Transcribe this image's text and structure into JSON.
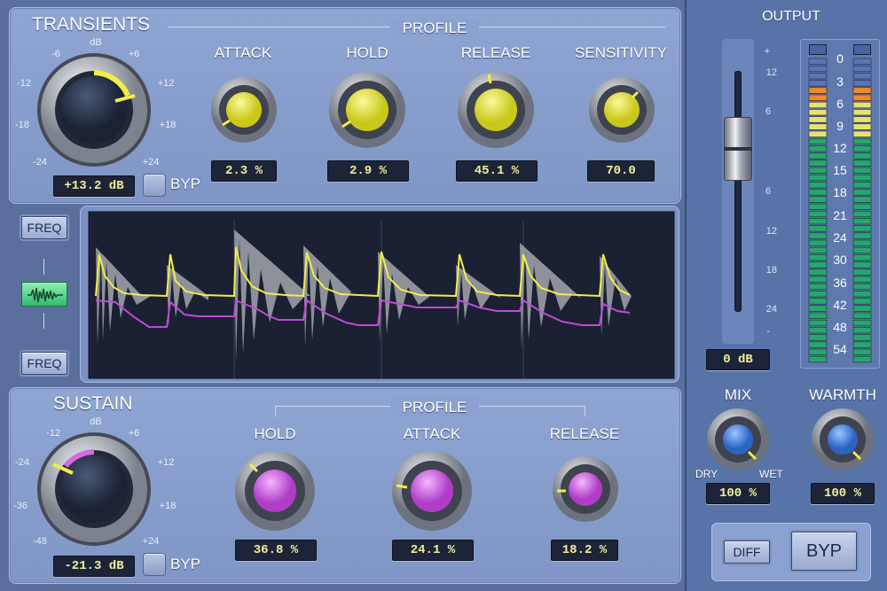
{
  "transients": {
    "title": "TRANSIENTS",
    "profile_label": "PROFILE",
    "gain_unit": "dB",
    "gain_ticks": [
      "-6",
      "+6",
      "-12",
      "+12",
      "-18",
      "+18",
      "-24",
      "+24"
    ],
    "gain_value": "+13.2 dB",
    "bypass_label": "BYP",
    "knobs": [
      {
        "label": "ATTACK",
        "value": "2.3 %"
      },
      {
        "label": "HOLD",
        "value": "2.9 %"
      },
      {
        "label": "RELEASE",
        "value": "45.1 %"
      },
      {
        "label": "SENSITIVITY",
        "value": "70.0"
      }
    ]
  },
  "sustain": {
    "title": "SUSTAIN",
    "profile_label": "PROFILE",
    "gain_unit": "dB",
    "gain_ticks": [
      "-12",
      "+6",
      "-24",
      "+12",
      "-36",
      "+18",
      "-48",
      "+24"
    ],
    "gain_value": "-21.3 dB",
    "bypass_label": "BYP",
    "knobs": [
      {
        "label": "HOLD",
        "value": "36.8 %"
      },
      {
        "label": "ATTACK",
        "value": "24.1 %"
      },
      {
        "label": "RELEASE",
        "value": "18.2 %"
      }
    ]
  },
  "display": {
    "freq_top_label": "FREQ",
    "freq_bottom_label": "FREQ",
    "waveform_icon": "waveform-icon"
  },
  "output": {
    "title": "OUTPUT",
    "fader_scale": [
      "+",
      "12",
      "6",
      "",
      "6",
      "12",
      "18",
      "24",
      "-"
    ],
    "fader_value": "0 dB",
    "meter_scale": [
      "0",
      "3",
      "6",
      "9",
      "12",
      "15",
      "18",
      "21",
      "24",
      "30",
      "36",
      "42",
      "48",
      "54"
    ],
    "mix_label": "MIX",
    "dry_label": "DRY",
    "wet_label": "WET",
    "mix_value": "100 %",
    "warmth_label": "WARMTH",
    "warmth_value": "100 %",
    "diff_label": "DIFF",
    "byp_label": "BYP"
  },
  "colors": {
    "accent_yellow": "#f0ee4a",
    "accent_purple": "#d66ae6",
    "accent_blue": "#3b78d8",
    "meter_green": "#26a86a",
    "meter_orange": "#f08a2a"
  }
}
